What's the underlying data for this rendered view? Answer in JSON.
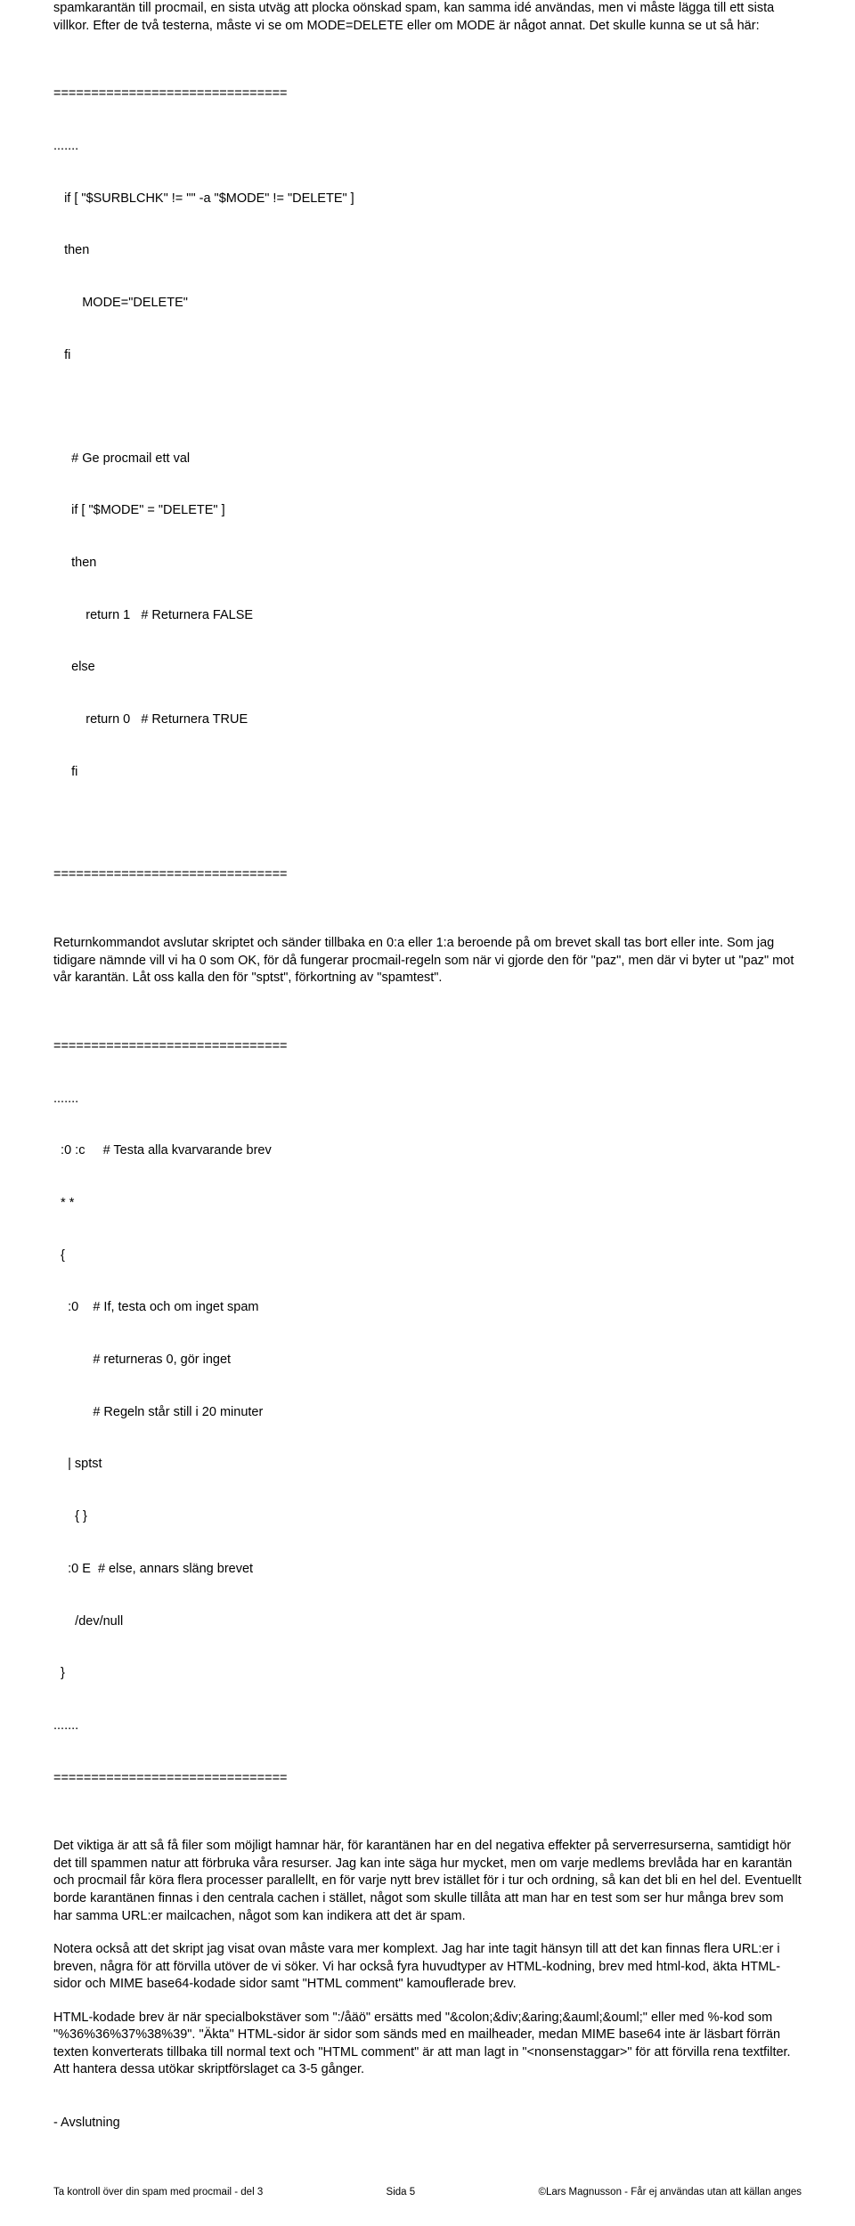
{
  "p1": "spamkarantän till procmail, en sista utväg att plocka oönskad spam, kan samma idé användas, men vi måste lägga till ett sista villkor. Efter de två testerna, måste vi se om MODE=DELETE eller om MODE är något annat. Det skulle kunna se ut så här:",
  "sep": "===============================",
  "dots": ".......",
  "c1a": "   if [ \"$SURBLCHK\" != \"\" -a \"$MODE\" != \"DELETE\" ]",
  "c1b": "   then",
  "c1c": "        MODE=\"DELETE\"",
  "c1d": "   fi",
  "c2a": "     # Ge procmail ett val",
  "c2b": "     if [ \"$MODE\" = \"DELETE\" ]",
  "c2c": "     then",
  "c2d": "         return 1   # Returnera FALSE",
  "c2e": "     else",
  "c2f": "         return 0   # Returnera TRUE",
  "c2g": "     fi",
  "p2": "Returnkommandot avslutar skriptet och sänder tillbaka en 0:a eller 1:a beroende på om brevet skall tas bort eller inte. Som jag tidigare nämnde vill vi ha 0 som OK, för då fungerar procmail-regeln som när vi gjorde den för \"paz\", men där vi byter ut \"paz\" mot vår karantän. Låt oss kalla den för \"sptst\", förkortning av \"spamtest\".",
  "c3a": "  :0 :c     # Testa alla kvarvarande brev",
  "c3b": "  * *",
  "c3c": "  {",
  "c3d": "    :0    # If, testa och om inget spam",
  "c3e": "           # returneras 0, gör inget",
  "c3f": "           # Regeln står still i 20 minuter",
  "c3g": "    | sptst",
  "c3h": "      { }",
  "c3i": "    :0 E  # else, annars släng brevet",
  "c3j": "      /dev/null",
  "c3k": "  }",
  "p3": "Det viktiga är att så få filer som möjligt hamnar här, för karantänen har en del negativa effekter på serverresurserna, samtidigt hör det till spammen natur att förbruka våra resurser. Jag kan inte säga hur mycket, men om varje medlems brevlåda har en karantän och procmail får köra flera processer parallellt, en för varje nytt brev istället för i tur och ordning, så kan det bli en hel del. Eventuellt borde karantänen finnas i den centrala cachen i stället, något som skulle tillåta att man har en test som ser hur många brev som har samma URL:er mailcachen, något som kan indikera att det är spam.",
  "p4": "Notera också att det skript jag visat ovan måste vara mer komplext. Jag har inte tagit hänsyn till att det kan finnas flera URL:er i breven, några för att förvilla utöver de vi söker. Vi har också fyra huvudtyper av HTML-kodning, brev med html-kod, äkta HTML-sidor och MIME base64-kodade sidor samt \"HTML comment\" kamouflerade brev.",
  "p5": "HTML-kodade brev är när specialbokstäver som \":/åäö\" ersätts med \"&colon;&div;&aring;&auml;&ouml;\" eller med %-kod som \"%36%36%37%38%39\". \"Äkta\" HTML-sidor är sidor som sänds med en mailheader, medan MIME base64 inte är läsbart förrän texten konverterats tillbaka till normal text och \"HTML comment\" är att man lagt in \"<nonsenstaggar>\" för att förvilla rena textfilter. Att hantera dessa utökar skriptförslaget ca 3-5 gånger.",
  "p6": "- Avslutning",
  "footer": {
    "left": "Ta kontroll över din spam med procmail - del 3",
    "center": "Sida  5",
    "right": "©Lars Magnusson -  Får ej användas utan att källan anges"
  }
}
